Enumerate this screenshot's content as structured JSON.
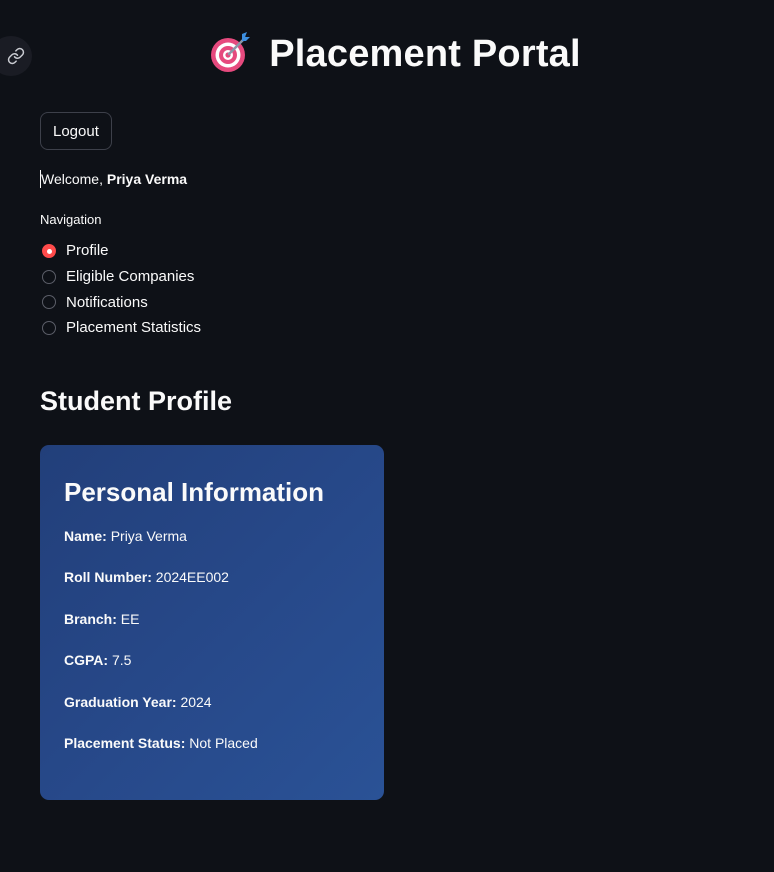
{
  "app": {
    "title": "Placement Portal",
    "title_icon": "dart-target-icon"
  },
  "auth": {
    "logout_label": "Logout",
    "welcome_prefix": "Welcome, ",
    "user_name": "Priya Verma"
  },
  "navigation": {
    "label": "Navigation",
    "options": [
      "Profile",
      "Eligible Companies",
      "Notifications",
      "Placement Statistics"
    ],
    "selected": "Profile"
  },
  "section": {
    "title": "Student Profile"
  },
  "card": {
    "title": "Personal Information",
    "fields": [
      {
        "label": "Name:",
        "value": "Priya Verma"
      },
      {
        "label": "Roll Number:",
        "value": "2024EE002"
      },
      {
        "label": "Branch:",
        "value": "EE"
      },
      {
        "label": "CGPA:",
        "value": "7.5"
      },
      {
        "label": "Graduation Year:",
        "value": "2024"
      },
      {
        "label": "Placement Status:",
        "value": "Not Placed"
      }
    ]
  },
  "colors": {
    "background": "#0e1117",
    "accent": "#ff4b4b",
    "card_start": "#223f7a",
    "card_end": "#2a5296"
  }
}
